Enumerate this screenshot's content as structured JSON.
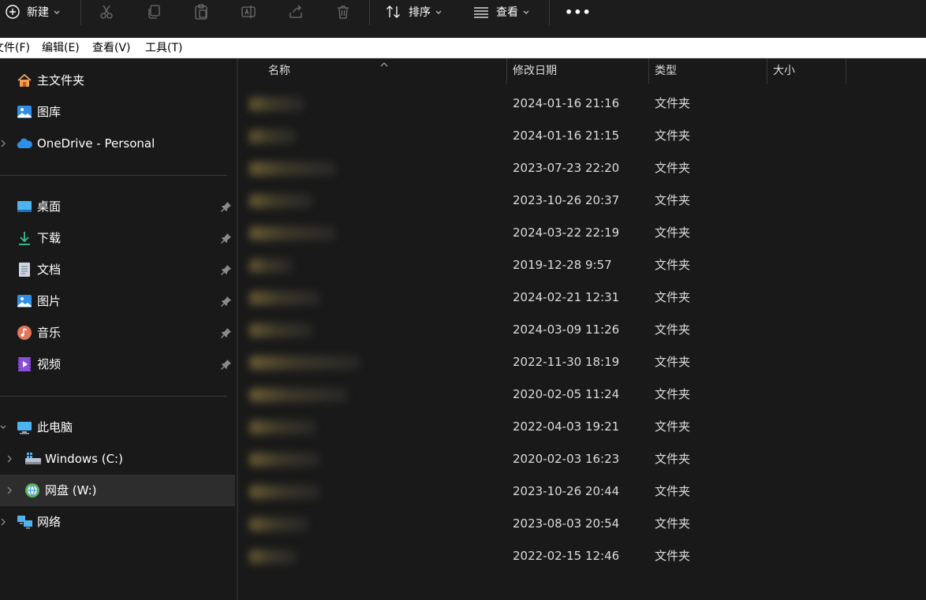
{
  "toolbar": {
    "new_label": "新建",
    "sort_label": "排序",
    "view_label": "查看",
    "more_label": "•••"
  },
  "menubar": {
    "file": "文件(F)",
    "edit": "编辑(E)",
    "view": "查看(V)",
    "tools": "工具(T)"
  },
  "sidebar": {
    "home": "主文件夹",
    "gallery": "图库",
    "onedrive": "OneDrive - Personal",
    "desktop": "桌面",
    "downloads": "下载",
    "documents": "文档",
    "pictures": "图片",
    "music": "音乐",
    "videos": "视频",
    "this_pc": "此电脑",
    "windows_drive": "Windows  (C:)",
    "net_drive": "网盘 (W:)",
    "network": "网络"
  },
  "columns": {
    "name": "名称",
    "modified": "修改日期",
    "type": "类型",
    "size": "大小"
  },
  "rows": [
    {
      "date": "2024-01-16 21:16",
      "type": "文件夹"
    },
    {
      "date": "2024-01-16 21:15",
      "type": "文件夹"
    },
    {
      "date": "2023-07-23 22:20",
      "type": "文件夹"
    },
    {
      "date": "2023-10-26 20:37",
      "type": "文件夹"
    },
    {
      "date": "2024-03-22 22:19",
      "type": "文件夹"
    },
    {
      "date": "2019-12-28 9:57",
      "type": "文件夹"
    },
    {
      "date": "2024-02-21 12:31",
      "type": "文件夹"
    },
    {
      "date": "2024-03-09 11:26",
      "type": "文件夹"
    },
    {
      "date": "2022-11-30 18:19",
      "type": "文件夹"
    },
    {
      "date": "2020-02-05 11:24",
      "type": "文件夹"
    },
    {
      "date": "2022-04-03 19:21",
      "type": "文件夹"
    },
    {
      "date": "2020-02-03 16:23",
      "type": "文件夹"
    },
    {
      "date": "2023-10-26 20:44",
      "type": "文件夹"
    },
    {
      "date": "2023-08-03 20:54",
      "type": "文件夹"
    },
    {
      "date": "2022-02-15 12:46",
      "type": "文件夹"
    }
  ],
  "colors": {
    "background": "#191919",
    "selected": "#2d2d2d",
    "folder_accent": "#e8b341",
    "onedrive_blue": "#2f8fe6"
  }
}
